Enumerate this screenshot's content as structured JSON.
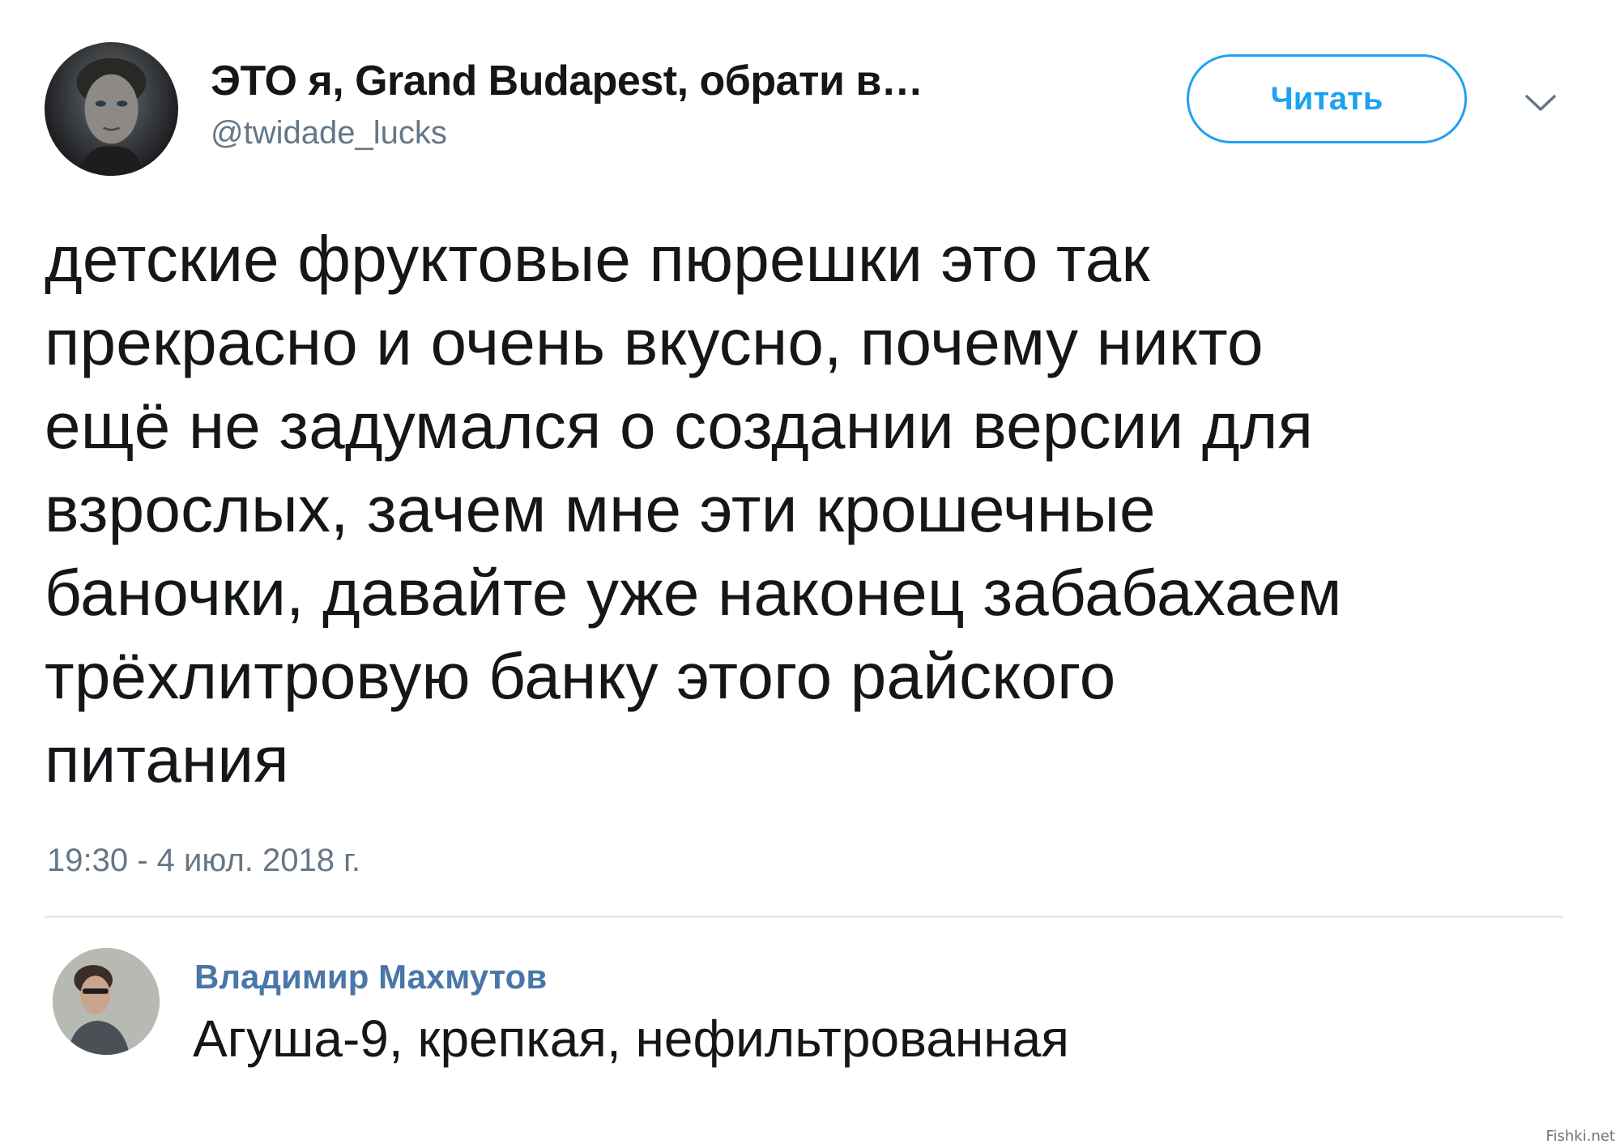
{
  "tweet": {
    "author_name": "ЭТО я, Grand Budapest, обрати в…",
    "author_handle": "@twidade_lucks",
    "follow_label": "Читать",
    "text": "детские фруктовые пюрешки это так\nпрекрасно и очень вкусно, почему никто\nещё не задумался о создании версии для\nвзрослых, зачем мне эти крошечные\nбаночки, давайте уже наконец забабахаем\nтрёхлитровую банку этого райского\nпитания",
    "timestamp": "19:30 - 4 июл. 2018 г."
  },
  "reply": {
    "author_name": "Владимир Махмутов",
    "text": "Агуша-9, крепкая, нефильтрованная"
  },
  "watermark": "Fishki.net",
  "colors": {
    "accent": "#1da1f2",
    "secondary_text": "#657786",
    "reply_name": "#4a76a8",
    "divider": "#e6ecf0"
  },
  "icons": {
    "menu": "chevron-down-icon"
  }
}
